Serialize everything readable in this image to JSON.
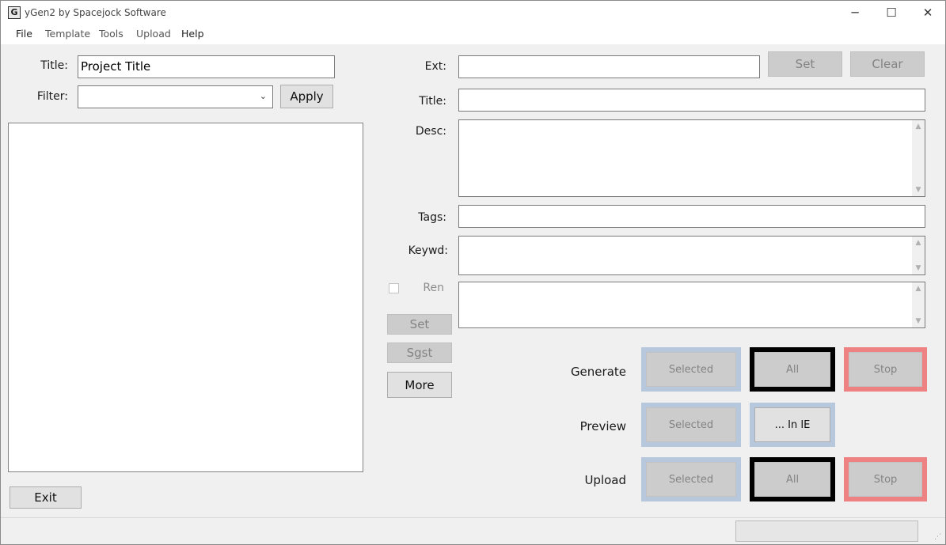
{
  "window": {
    "title": "yGen2 by Spacejock Software",
    "app_icon_glyph": "G",
    "minimize_glyph": "─",
    "maximize_glyph": "☐",
    "close_glyph": "✕"
  },
  "menu": [
    "File",
    "Template",
    "Tools",
    "Upload",
    "Help"
  ],
  "left": {
    "title_label": "Title:",
    "title_value": "Project Title",
    "filter_label": "Filter:",
    "filter_value": "",
    "apply_label": "Apply",
    "exit_label": "Exit"
  },
  "right": {
    "ext_label": "Ext:",
    "ext_value": "",
    "set_label": "Set",
    "clear_label": "Clear",
    "title_label": "Title:",
    "title_value": "",
    "desc_label": "Desc:",
    "tags_label": "Tags:",
    "tags_value": "",
    "keywd_label": "Keywd:",
    "ren_label": "Ren",
    "set2_label": "Set",
    "sgst_label": "Sgst",
    "more_label": "More"
  },
  "generate": {
    "label": "Generate",
    "selected_label": "Selected",
    "all_label": "All",
    "stop_label": "Stop"
  },
  "preview": {
    "label": "Preview",
    "selected_label": "Selected",
    "in_ie_label": "... In IE"
  },
  "upload": {
    "label": "Upload",
    "selected_label": "Selected",
    "all_label": "All",
    "stop_label": "Stop"
  },
  "icons": {
    "scroll_up": "▲",
    "scroll_down": "▼",
    "combo_arrow": "⌄",
    "grip": "⋰"
  },
  "colors": {
    "frame_blue": "#b8c8dc",
    "frame_black": "#000000",
    "frame_red": "#ee8282",
    "window_bg": "#f0f0f0"
  }
}
